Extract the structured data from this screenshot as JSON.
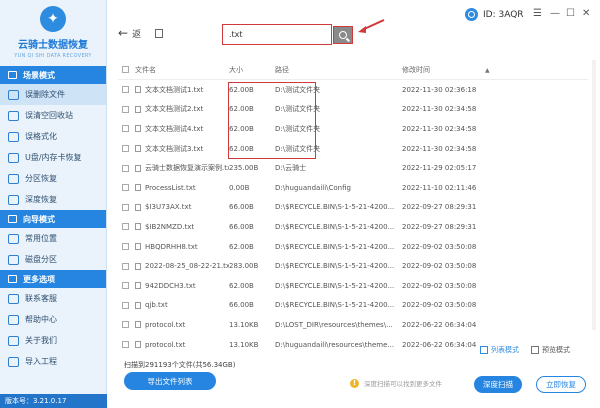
{
  "app": {
    "title": "云骑士数据恢复",
    "subtitle": "YUN QI SHI DATA RECOVERY",
    "version": "版本号：3.21.0.17",
    "id_label": "ID: 3AQR"
  },
  "sidebar": {
    "sections": [
      {
        "title": "场景模式",
        "items": [
          "误删除文件",
          "误清空回收站",
          "误格式化",
          "U盘/内存卡恢复",
          "分区恢复",
          "深度恢复"
        ]
      },
      {
        "title": "向导模式",
        "items": [
          "常用位置",
          "磁盘分区"
        ]
      },
      {
        "title": "更多选项",
        "items": [
          "联系客服",
          "帮助中心",
          "关于我们",
          "导入工程"
        ]
      }
    ]
  },
  "toolbar": {
    "back_label": "返",
    "search_value": ".txt"
  },
  "table": {
    "headers": [
      "文件名",
      "大小",
      "路径",
      "修改时间"
    ],
    "rows": [
      {
        "name": "文本文档测试1.txt",
        "size": "62.00B",
        "path": "D:\\测试文件夹",
        "time": "2022-11-30 02:36:18"
      },
      {
        "name": "文本文档测试2.txt",
        "size": "62.00B",
        "path": "D:\\测试文件夹",
        "time": "2022-11-30 02:34:58"
      },
      {
        "name": "文本文档测试4.txt",
        "size": "62.00B",
        "path": "D:\\测试文件夹",
        "time": "2022-11-30 02:34:58"
      },
      {
        "name": "文本文档测试3.txt",
        "size": "62.00B",
        "path": "D:\\测试文件夹",
        "time": "2022-11-30 02:34:58"
      },
      {
        "name": "云骑士数据恢复演示案例.txt",
        "size": "235.00B",
        "path": "D:\\云骑士",
        "time": "2022-11-29 02:05:17"
      },
      {
        "name": "ProcessList.txt",
        "size": "0.00B",
        "path": "D:\\huguandaili\\Config",
        "time": "2022-11-10 02:11:46"
      },
      {
        "name": "$I3U73AX.txt",
        "size": "66.00B",
        "path": "D:\\$RECYCLE.BIN\\S-1-5-21-4200...",
        "time": "2022-09-27 08:29:31"
      },
      {
        "name": "$IB2NMZD.txt",
        "size": "66.00B",
        "path": "D:\\$RECYCLE.BIN\\S-1-5-21-4200...",
        "time": "2022-09-27 08:29:31"
      },
      {
        "name": "HBQDRHH8.txt",
        "size": "62.00B",
        "path": "D:\\$RECYCLE.BIN\\S-1-5-21-4200...",
        "time": "2022-09-02 03:50:08"
      },
      {
        "name": "2022-08-25_08-22-21.txt",
        "size": "283.00B",
        "path": "D:\\$RECYCLE.BIN\\S-1-5-21-4200...",
        "time": "2022-09-02 03:50:08"
      },
      {
        "name": "942DDCH3.txt",
        "size": "62.00B",
        "path": "D:\\$RECYCLE.BIN\\S-1-5-21-4200...",
        "time": "2022-09-02 03:50:08"
      },
      {
        "name": "qjb.txt",
        "size": "66.00B",
        "path": "D:\\$RECYCLE.BIN\\S-1-5-21-4200...",
        "time": "2022-09-02 03:50:08"
      },
      {
        "name": "protocol.txt",
        "size": "13.10KB",
        "path": "D:\\LOST_DIR\\resources\\themes\\...",
        "time": "2022-06-22 06:34:04"
      },
      {
        "name": "protocol.txt",
        "size": "13.10KB",
        "path": "D:\\huguandaili\\resources\\theme...",
        "time": "2022-06-22 06:34:04"
      }
    ]
  },
  "views": {
    "list": "列表模式",
    "preview": "预览模式"
  },
  "footer": {
    "scan_info": "扫描到291193个文件(共56.34GB)",
    "export_label": "导出文件列表",
    "tip": "深度扫描可以找到更多文件",
    "deep_scan_label": "深度扫描",
    "recover_label": "立即恢复"
  }
}
